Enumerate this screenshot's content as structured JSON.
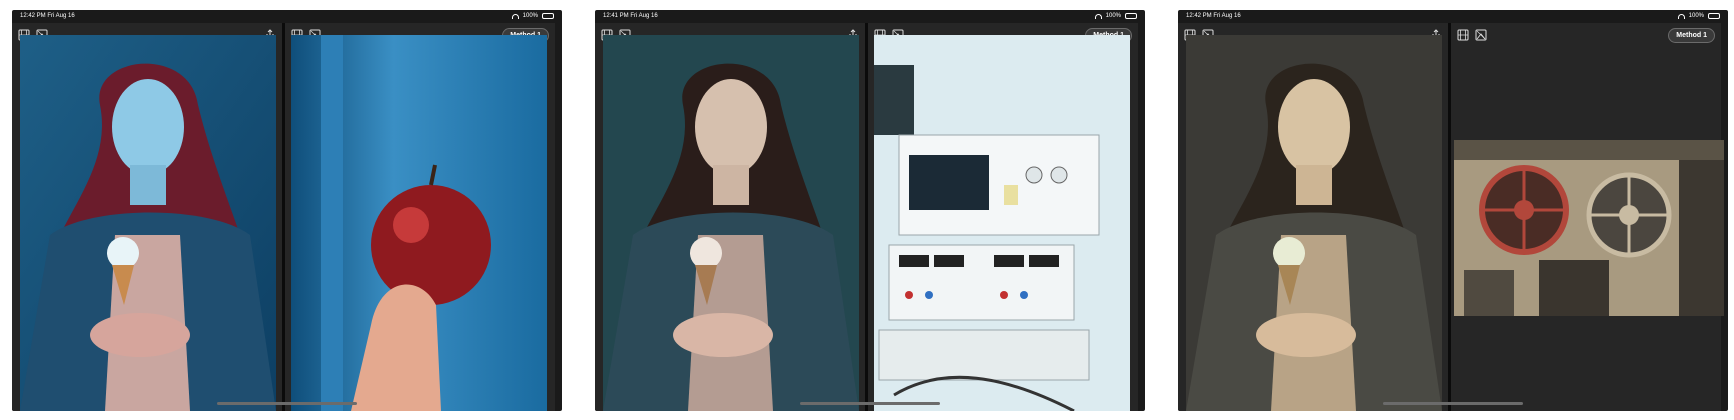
{
  "screens": [
    {
      "status_time": "12:42 PM  Fri Aug 16",
      "battery": "100%",
      "method_label": "Method 1",
      "left_photo": "woman-with-ice-cream-blue-tint",
      "right_photo": "hand-holding-red-apple"
    },
    {
      "status_time": "12:41 PM  Fri Aug 16",
      "battery": "100%",
      "method_label": "Method 1",
      "left_photo": "woman-with-ice-cream-teal-tint",
      "right_photo": "laboratory-electronics-equipment"
    },
    {
      "status_time": "12:42 PM  Fri Aug 16",
      "battery": "100%",
      "method_label": "Method 1",
      "left_photo": "woman-with-ice-cream-sepia-tint",
      "right_photo": "film-projector-reels"
    }
  ],
  "icons": {
    "film": "film-icon",
    "image": "image-icon",
    "share": "share-icon",
    "wifi": "wifi-icon",
    "battery": "battery-icon"
  },
  "colors": {
    "device_bg": "#1a1a1a",
    "pane_bg": "#262626",
    "divider": "#0b0b0b"
  }
}
